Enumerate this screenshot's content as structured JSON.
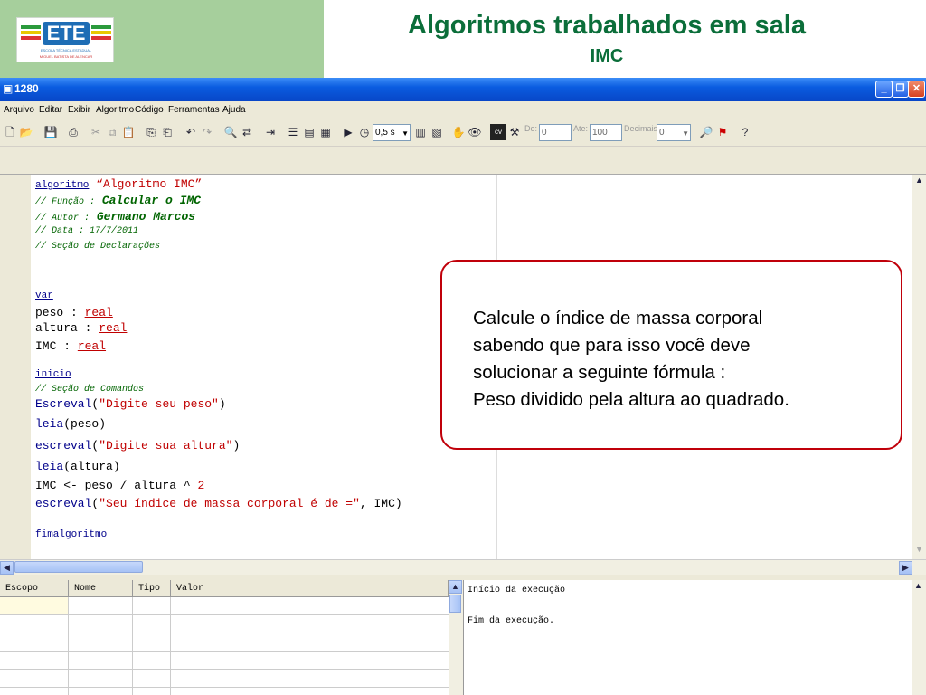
{
  "slide": {
    "title": "Algoritmos trabalhados em sala",
    "subtitle": "IMC",
    "logo_text": "ETE",
    "logo_sub": "ESCOLA TÉCNICA ESTADUAL",
    "logo_sub2": "MIGUEL BATISTA DE ALENCAR"
  },
  "window": {
    "title": "1280"
  },
  "menu": [
    "Arquivo",
    "Editar",
    "Exibir",
    "Algoritmo",
    "Código",
    "Ferramentas",
    "Ajuda"
  ],
  "toolbar": {
    "speed_value": "0,5 s",
    "de_label": "De:",
    "de_value": "0",
    "ate_label": "Ate:",
    "ate_value": "100",
    "decimais_label": "Decimais:",
    "decimais_value": "0"
  },
  "code": {
    "l1_kw": "algoritmo",
    "l1_str": "“Algoritmo IMC”",
    "l2_c": "// Função :",
    "l2_b": "Calcular o IMC",
    "l3_c": "// Autor :",
    "l3_b": "Germano Marcos",
    "l4": "// Data : 17/7/2011",
    "l5": "// Seção de Declarações",
    "var": "var",
    "peso": "peso : ",
    "altura": "altura : ",
    "imc": "IMC : ",
    "real": "real",
    "inicio": "inicio",
    "cmd": "// Seção de Comandos",
    "escreval1_fn": "Escreval",
    "escreval1_str": "\"Digite seu peso\"",
    "leia1_fn": "leia",
    "leia1_arg": "(peso)",
    "escreval2_fn": "escreval",
    "escreval2_str": "\"Digite sua altura\"",
    "leia2_fn": "leia",
    "leia2_arg": "(altura)",
    "calc": "IMC <- peso / altura ^ ",
    "calc_num": "2",
    "escreval3_fn": "escreval",
    "escreval3_str": "\"Seu índice de massa corporal é de =\"",
    "escreval3_tail": ", IMC)",
    "fim": "fimalgoritmo"
  },
  "callout": {
    "line1": "Calcule o índice de massa corporal",
    "line2": "sabendo que para isso você deve",
    "line3": "solucionar a seguinte fórmula :",
    "line4": "Peso dividido pela altura ao quadrado."
  },
  "vars_table": {
    "headers": [
      "Escopo",
      "Nome",
      "Tipo",
      "Valor"
    ]
  },
  "output": {
    "line1": "Início da execução",
    "line2": "Fim da execução."
  },
  "colors": {
    "title_green": "#0b6e3a",
    "header_green": "#a6cf9c",
    "callout_border": "#c0000a",
    "titlebar_blue": "#0a5ce0"
  }
}
